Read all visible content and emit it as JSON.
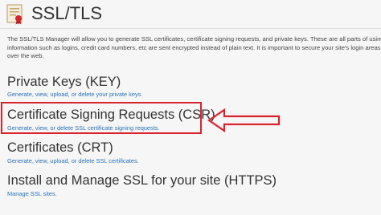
{
  "header": {
    "title": "SSL/TLS"
  },
  "intro": {
    "line1": "The SSL/TLS Manager will allow you to generate SSL certificates, certificate signing requests, and private keys. These are all parts of using SSL",
    "line2": "information such as logins, credit card numbers, etc are sent encrypted instead of plain text. It is important to secure your site's login areas, sh",
    "line3": "over the web."
  },
  "sections": [
    {
      "title": "Private Keys (KEY)",
      "link": "Generate, view, upload, or delete your private keys."
    },
    {
      "title": "Certificate Signing Requests (CSR)",
      "link": "Generate, view, or delete SSL certificate signing requests."
    },
    {
      "title": "Certificates (CRT)",
      "link": "Generate, view, upload, or delete SSL certificates."
    },
    {
      "title": "Install and Manage SSL for your site (HTTPS)",
      "link": "Manage SSL sites."
    }
  ],
  "annotation": {
    "color": "#d9232e",
    "arrow_icon": "left-arrow-annotation-icon"
  },
  "colors": {
    "link": "#2a73b8",
    "background": "#f6f6f6"
  }
}
